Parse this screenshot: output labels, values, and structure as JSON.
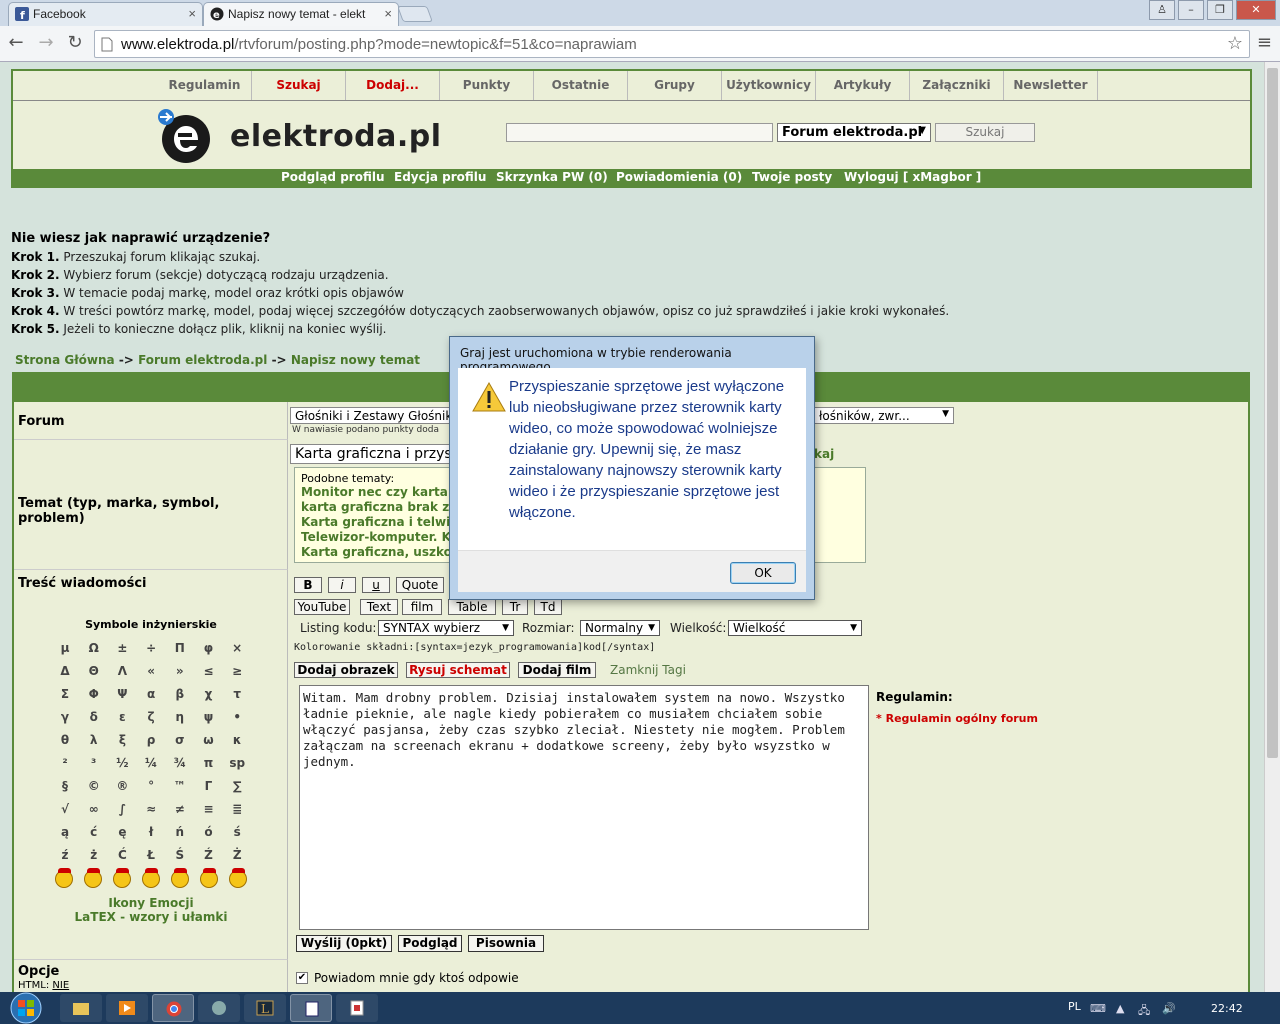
{
  "browser": {
    "tabs": [
      {
        "label": "Facebook",
        "icon": "facebook-icon"
      },
      {
        "label": "Napisz nowy temat - elekt",
        "icon": "elektroda-icon"
      }
    ],
    "url_host": "www.elektroda.pl",
    "url_path": "/rtvforum/posting.php?mode=newtopic&f=51&co=naprawiam"
  },
  "site": {
    "nav": [
      "Regulamin",
      "Szukaj",
      "Dodaj...",
      "Punkty",
      "Ostatnie",
      "Grupy",
      "Użytkownicy",
      "Artykuły",
      "Załączniki",
      "Newsletter"
    ],
    "logo_text": "elektroda.pl",
    "forum_select": "Forum elektroda.pl",
    "search_button": "Szukaj",
    "user_links": [
      "Podgląd profilu",
      "Edycja profilu",
      "Skrzynka PW (0)",
      "Powiadomienia (0)",
      "Twoje posty",
      "Wyloguj [ xMagbor ]"
    ]
  },
  "help": {
    "question": "Nie wiesz jak naprawić urządzenie?",
    "steps": [
      {
        "label": "Krok 1.",
        "text": "Przeszukaj forum klikając szukaj."
      },
      {
        "label": "Krok 2.",
        "text": "Wybierz forum (sekcje) dotyczącą rodzaju urządzenia."
      },
      {
        "label": "Krok 3.",
        "text": "W temacie podaj markę, model oraz krótki opis objawów"
      },
      {
        "label": "Krok 4.",
        "text": "W treści powtórz markę, model, podaj więcej szczegółów dotyczących zaobserwowanych objawów, opisz co już sprawdziłeś i jakie kroki wykonałeś."
      },
      {
        "label": "Krok 5.",
        "text": "Jeżeli to konieczne dołącz plik, kliknij na koniec wyślij."
      }
    ]
  },
  "breadcrumb": {
    "home": "Strona Główna",
    "forum": "Forum elektroda.pl",
    "current": "Napisz nowy temat",
    "sep": "->"
  },
  "form": {
    "forum_label": "Forum",
    "forum_value": "Głośniki i Zestawy Głośniko",
    "forum_value_right": "łośników, zwr...",
    "forum_note": "W nawiasie podano punkty doda",
    "topic_label": "Temat (typ, marka, symbol, problem)",
    "topic_value": "Karta graficzna i przysp",
    "topic_side": "kaj",
    "similar_title": "Podobne tematy:",
    "similar": [
      "Monitor nec czy karta gr",
      "karta graficzna brak ziel",
      "Karta graficzna i telwizo",
      "Telewizor-komputer. Ka",
      "Karta graficzna, uszkodz"
    ],
    "message_label": "Treść wiadomości",
    "symbols_title": "Symbole inżynierskie",
    "symbols": [
      [
        "μ",
        "Ω",
        "±",
        "÷",
        "Π",
        "φ",
        "×"
      ],
      [
        "Δ",
        "Θ",
        "Λ",
        "«",
        "»",
        "≤",
        "≥"
      ],
      [
        "Σ",
        "Φ",
        "Ψ",
        "α",
        "β",
        "χ",
        "τ"
      ],
      [
        "γ",
        "δ",
        "ε",
        "ζ",
        "η",
        "ψ",
        "•"
      ],
      [
        "θ",
        "λ",
        "ξ",
        "ρ",
        "σ",
        "ω",
        "κ"
      ],
      [
        "²",
        "³",
        "½",
        "¼",
        "¾",
        "π",
        "sp"
      ],
      [
        "§",
        "©",
        "®",
        "°",
        "™",
        "Γ",
        "∑"
      ],
      [
        "√",
        "∞",
        "∫",
        "≈",
        "≠",
        "≡",
        "≣"
      ],
      [
        "ą",
        "ć",
        "ę",
        "ł",
        "ń",
        "ó",
        "ś"
      ],
      [
        "ź",
        "ż",
        "Ć",
        "Ł",
        "Ś",
        "Ź",
        "Ż"
      ]
    ],
    "emoji_link": "Ikony Emocji",
    "latex_link": "LaTEX - wzory i ułamki",
    "fmt_buttons": [
      "B",
      "i",
      "u",
      "Quote"
    ],
    "fmt_buttons2": [
      "YouTube",
      "Text",
      "film",
      "Table",
      "Tr",
      "Td"
    ],
    "listing_label": "Listing kodu:",
    "listing_value": "SYNTAX wybierz",
    "size_label": "Rozmiar:",
    "size_value": "Normalny",
    "font_label": "Wielkość:",
    "font_value": "Wielkość",
    "syntax_hint": "Kolorowanie składni:[syntax=jezyk_programowania]kod[/syntax]",
    "media_buttons": [
      "Dodaj obrazek",
      "Rysuj schemat",
      "Dodaj film"
    ],
    "close_tags": "Zamknij Tagi",
    "message": "Witam. Mam drobny problem. Dzisiaj instalowałem system na nowo. Wszystko ładnie pieknie, ale nagle kiedy pobierałem co musiałem chciałem sobie włączyć pasjansa, żeby czas szybko zleciał. Niestety nie mogłem. Problem załączam na screenach ekranu + dodatkowe screeny, żeby było wsyzstko w jednym.",
    "rules_label": "Regulamin:",
    "rules_link": "Regulamin ogólny forum",
    "submit_buttons": [
      "Wyślij (0pkt)",
      "Podgląd",
      "Pisownia"
    ],
    "options_label": "Opcje",
    "html_label": "HTML:",
    "html_value": "NIE",
    "notify_label": "Powiadom mnie gdy ktoś odpowie"
  },
  "dialog": {
    "title": "Graj jest uruchomiona w trybie renderowania programowego",
    "message": "Przyspieszanie sprzętowe jest wyłączone lub nieobsługiwane przez sterownik karty wideo, co może spowodować wolniejsze działanie gry. Upewnij się, że masz zainstalowany najnowszy sterownik karty wideo i że przyspieszanie sprzętowe jest włączone.",
    "ok": "OK"
  },
  "taskbar": {
    "lang": "PL",
    "clock": "22:42"
  }
}
